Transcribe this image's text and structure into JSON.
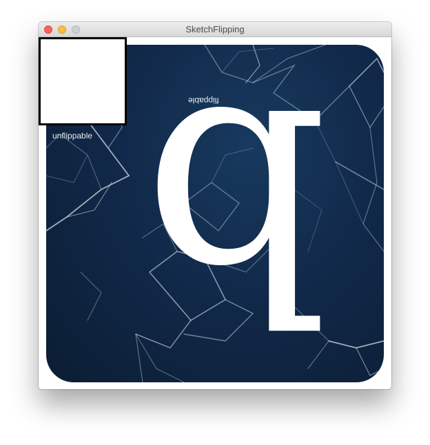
{
  "window": {
    "title": "SketchFlipping"
  },
  "canvas": {
    "flippable_label": "flippable",
    "unflippable_label": "unflippable",
    "big_glyph": "b",
    "background_colors": [
      "#173a5e",
      "#11294a",
      "#0b1d33"
    ]
  }
}
